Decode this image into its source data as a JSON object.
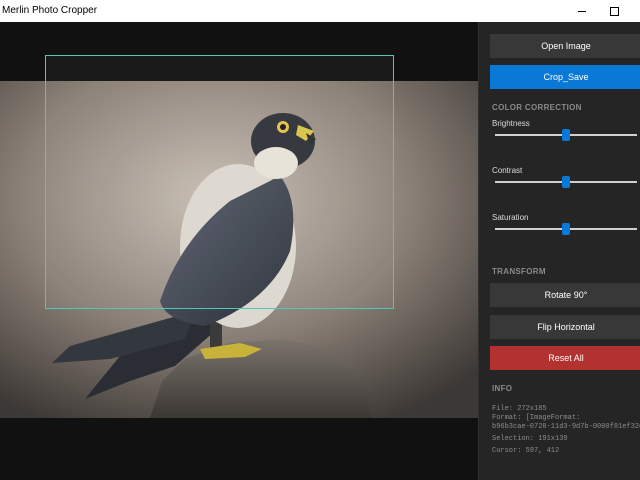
{
  "window": {
    "title": "Merlin Photo Cropper"
  },
  "canvas": {
    "image_description": "peregrine falcon perched on a rock"
  },
  "panel": {
    "open_image_label": "Open Image",
    "crop_save_label": "Crop_Save",
    "color_correction_title": "COLOR CORRECTION",
    "sliders": [
      {
        "label": "Brightness",
        "value": 0.5
      },
      {
        "label": "Contrast",
        "value": 0.5
      },
      {
        "label": "Saturation",
        "value": 0.5
      }
    ],
    "transform_title": "TRANSFORM",
    "rotate_label": "Rotate 90°",
    "flip_label": "Flip Horizontal",
    "reset_label": "Reset All",
    "info_title": "INFO",
    "info": {
      "file": "File: 272x185",
      "format_line1": "Format: [ImageFormat:",
      "format_line2": "b96b3cae-0728-11d3-9d7b-0000f81ef32e]",
      "selection": "Selection: 191x139",
      "cursor": "Cursor: 597, 412"
    }
  },
  "colors": {
    "accent": "#0a78d7",
    "danger": "#b3312f",
    "selection_border": "#4ec9b8",
    "panel_bg": "#252526"
  }
}
